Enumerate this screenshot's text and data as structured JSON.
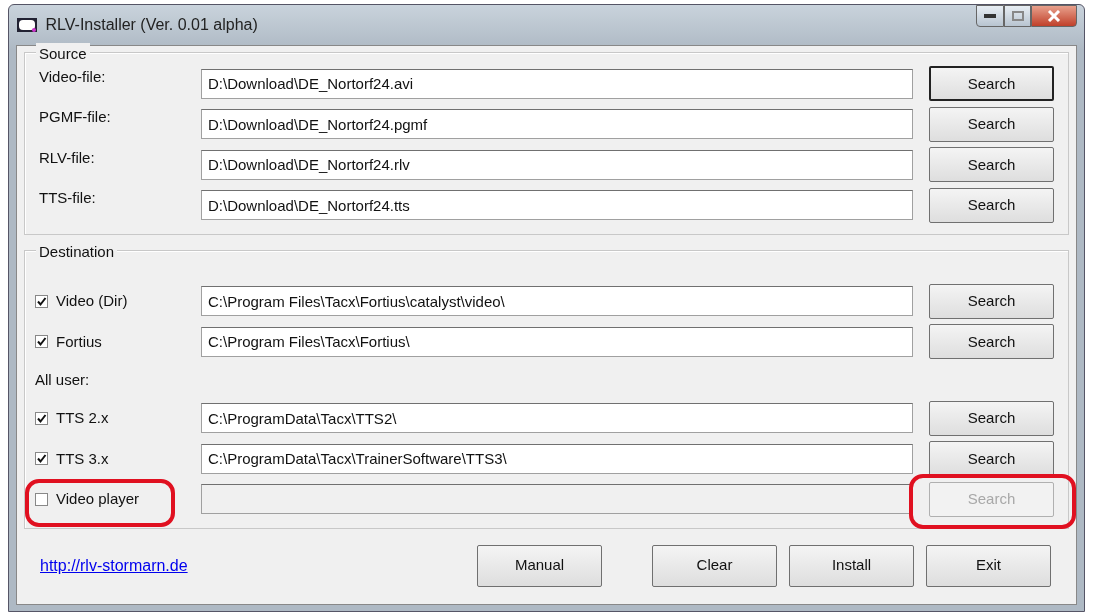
{
  "window": {
    "title": "RLV-Installer (Ver. 0.01 alpha)"
  },
  "source": {
    "legend": "Source",
    "rows": [
      {
        "label": "Video-file:",
        "value": "D:\\Download\\DE_Nortorf24.avi",
        "button": "Search",
        "focused": true
      },
      {
        "label": "PGMF-file:",
        "value": "D:\\Download\\DE_Nortorf24.pgmf",
        "button": "Search",
        "focused": false
      },
      {
        "label": "RLV-file:",
        "value": "D:\\Download\\DE_Nortorf24.rlv",
        "button": "Search",
        "focused": false
      },
      {
        "label": "TTS-file:",
        "value": "D:\\Download\\DE_Nortorf24.tts",
        "button": "Search",
        "focused": false
      }
    ]
  },
  "destination": {
    "legend": "Destination",
    "rows": [
      {
        "kind": "checkbox",
        "label": "Video (Dir)",
        "checked": true,
        "value": "C:\\Program Files\\Tacx\\Fortius\\catalyst\\video\\",
        "button": "Search",
        "disabled": false,
        "highlighted": false
      },
      {
        "kind": "checkbox",
        "label": "Fortius",
        "checked": true,
        "value": "C:\\Program Files\\Tacx\\Fortius\\",
        "button": "Search",
        "disabled": false,
        "highlighted": false
      },
      {
        "kind": "heading",
        "label": "All user:"
      },
      {
        "kind": "checkbox",
        "label": "TTS 2.x",
        "checked": true,
        "value": "C:\\ProgramData\\Tacx\\TTS2\\",
        "button": "Search",
        "disabled": false,
        "highlighted": false
      },
      {
        "kind": "checkbox",
        "label": "TTS 3.x",
        "checked": true,
        "value": "C:\\ProgramData\\Tacx\\TrainerSoftware\\TTS3\\",
        "button": "Search",
        "disabled": false,
        "highlighted": false
      },
      {
        "kind": "checkbox",
        "label": "Video player",
        "checked": false,
        "button": "Search",
        "disabled": true,
        "highlighted": true
      }
    ]
  },
  "footer": {
    "link": "http://rlv-stormarn.de",
    "buttons": [
      "Manual",
      "Clear",
      "Install",
      "Exit"
    ]
  }
}
